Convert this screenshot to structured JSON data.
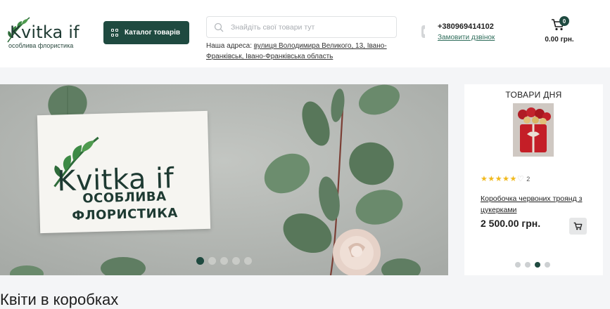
{
  "header": {
    "logo_text": "Kvitka if",
    "logo_tagline": "особлива флористика",
    "catalog_button": "Каталог товарів",
    "search_placeholder": "Знайдіть свої товари тут",
    "address_label": "Наша адреса:",
    "address_link": "вулиця Володимира Великого, 13, Івано-Франківськ, Івано-Франківська область",
    "phone": "+380969414102",
    "callback_link": "Замовити дзвінок",
    "cart_count": "0",
    "cart_total": "0.00 грн."
  },
  "hero": {
    "card_brand": "Kvitka if",
    "card_line1": "ОСОБЛИВА",
    "card_line2": "ФЛОРИСТИКА",
    "slides": 5,
    "active_slide": 0
  },
  "deal": {
    "title": "ТОВАРИ ДНЯ",
    "rating": 5,
    "reviews": "2",
    "product_name": "Коробочка червоних троянд з цукерками",
    "price": "2 500.00 грн.",
    "slides": 4,
    "active_slide": 2
  },
  "section": {
    "title": "Квіти в коробках"
  },
  "colors": {
    "brand": "#1f4a40",
    "stars": "#f1b91c"
  }
}
